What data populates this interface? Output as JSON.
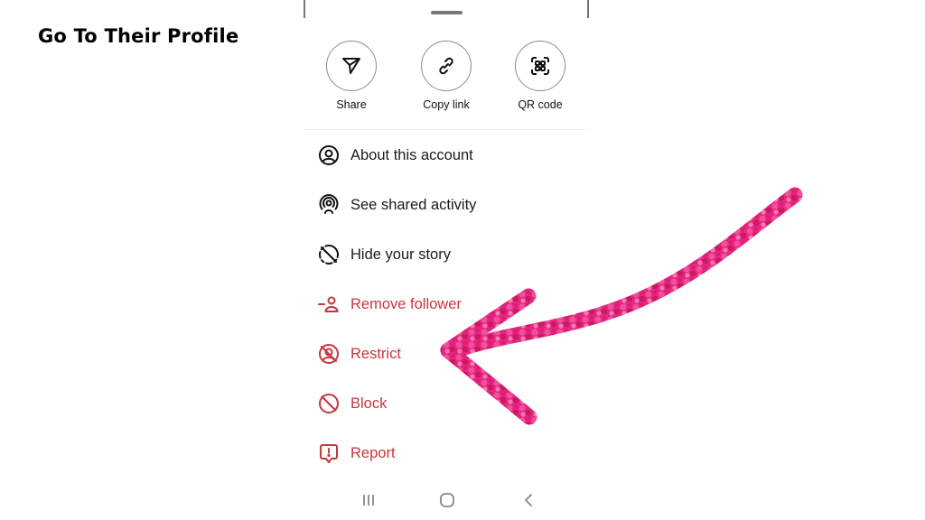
{
  "headline": "Go To Their Profile",
  "sheet": {
    "quick_actions": [
      {
        "label": "Share",
        "icon": "send-icon"
      },
      {
        "label": "Copy link",
        "icon": "link-icon"
      },
      {
        "label": "QR code",
        "icon": "qr-code-icon"
      }
    ],
    "menu_items": [
      {
        "label": "About this account",
        "icon": "account-circle-icon",
        "style": "normal"
      },
      {
        "label": "See shared activity",
        "icon": "shared-activity-icon",
        "style": "normal"
      },
      {
        "label": "Hide your story",
        "icon": "hide-story-icon",
        "style": "normal"
      },
      {
        "label": "Remove follower",
        "icon": "remove-person-icon",
        "style": "danger"
      },
      {
        "label": "Restrict",
        "icon": "restrict-icon",
        "style": "danger"
      },
      {
        "label": "Block",
        "icon": "block-icon",
        "style": "danger"
      },
      {
        "label": "Report",
        "icon": "report-icon",
        "style": "danger"
      }
    ]
  },
  "system_nav": {
    "recents": "recents-icon",
    "home": "home-icon",
    "back": "back-icon"
  },
  "colors": {
    "danger": "#c7363d",
    "arrow": "#e8247f"
  }
}
